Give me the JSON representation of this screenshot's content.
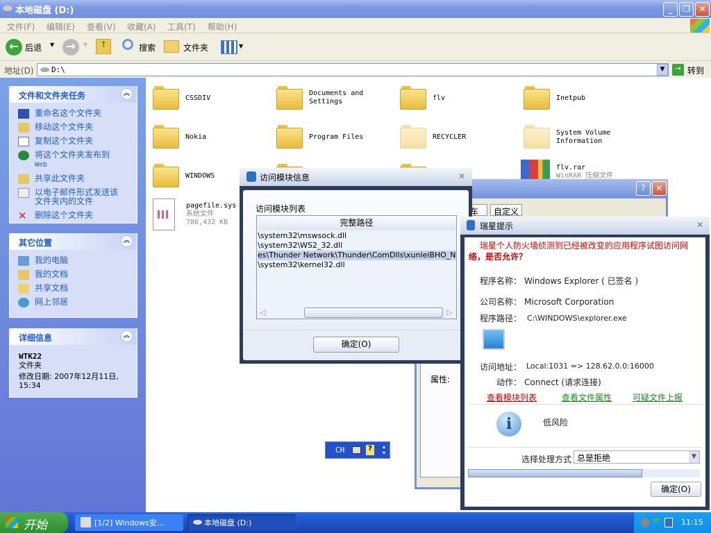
{
  "window": {
    "title": "本地磁盘 (D:)"
  },
  "menu": [
    "文件(F)",
    "编辑(E)",
    "查看(V)",
    "收藏(A)",
    "工具(T)",
    "帮助(H)"
  ],
  "toolbar": {
    "back": "后退",
    "search": "搜索",
    "folders": "文件夹"
  },
  "address": {
    "label": "地址(D)",
    "value": "D:\\",
    "go": "转到"
  },
  "tasks": {
    "title": "文件和文件夹任务",
    "items": [
      "重命名这个文件夹",
      "移动这个文件夹",
      "复制这个文件夹",
      "将这个文件夹发布到",
      "Web",
      "共享此文件夹",
      "以电子邮件形式发送该",
      "文件夹内的文件",
      "删除这个文件夹"
    ]
  },
  "places": {
    "title": "其它位置",
    "items": [
      "我的电脑",
      "我的文档",
      "共享文档",
      "网上邻居"
    ]
  },
  "details": {
    "title": "详细信息",
    "name": "WTK22",
    "type": "文件夹",
    "modified": "修改日期: 2007年12月11日,",
    "time": "15:34"
  },
  "files": [
    {
      "name": "CSSDIV"
    },
    {
      "name": "Documents and",
      "name2": "Settings"
    },
    {
      "name": "flv"
    },
    {
      "name": "Inetpub"
    },
    {
      "name": "Nokia"
    },
    {
      "name": "Program Files"
    },
    {
      "name": "RECYCLER"
    },
    {
      "name": "System Volume",
      "name2": "Information"
    },
    {
      "name": "WINDOWS"
    },
    {
      "name": "flv.rar",
      "name2": "WinRAR 压缩文件"
    },
    {
      "name": "pagefile.sys",
      "name2": "系统文件",
      "name3": "786,432 KB"
    }
  ],
  "module_dialog": {
    "title": "访问模块信息",
    "list_label": "访问模块列表",
    "column": "完整路径",
    "rows": [
      "\\system32\\mswsock.dll",
      "\\system32\\WS2_32.dll",
      "es\\Thunder Network\\Thunder\\ComDlls\\xunleiBHO_Now.dll",
      "\\system32\\kernel32.dll"
    ],
    "ok": "确定(O)"
  },
  "back_dialog": {
    "tab_partial": "车",
    "tab_custom": "自定义",
    "attr_label": "属性:"
  },
  "rising": {
    "title": "瑞星提示",
    "warning1": "瑞星个人防火墙侦测到已经被改变的应用程序试图访问网",
    "warning2": "络，是否允许？",
    "prog_label": "程序名称：",
    "prog_value": "Windows Explorer ( 已签名 )",
    "company_label": "公司名称：",
    "company_value": "Microsoft Corporation",
    "path_label": "程序路径：",
    "path_value": "C:\\WINDOWS\\explorer.exe",
    "addr_label": "访问地址：",
    "addr_value": "Local:1031 => 128.62.0.0:16000",
    "action_label": "动作：",
    "action_value": "Connect (请求连接)",
    "link_modules": "查看模块列表",
    "link_props": "查看文件属性",
    "link_report": "可疑文件上报",
    "risk": "低风险",
    "handle_label": "选择处理方式",
    "handle_value": "总是拒绝",
    "progress": 0.75,
    "ok": "确定(O)"
  },
  "langbar": {
    "lang": "CH"
  },
  "taskbar": {
    "start": "开始",
    "tasks": [
      "[1/2] Windows安...",
      "本地磁盘 (D:)"
    ],
    "clock": "11:15"
  }
}
